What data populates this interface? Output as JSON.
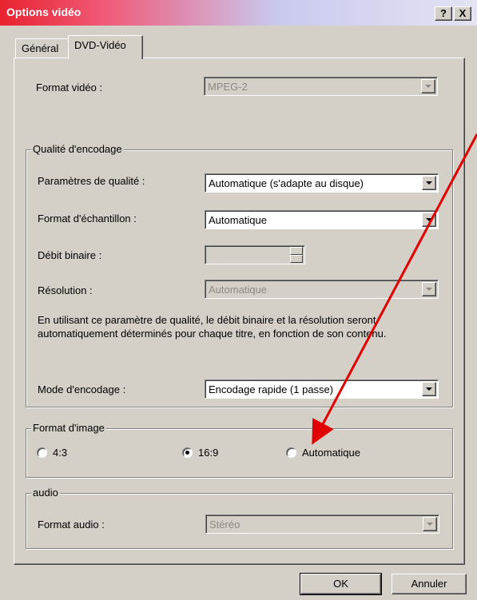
{
  "window": {
    "title": "Options vidéo",
    "help_button": "?",
    "close_button": "X"
  },
  "tabs": [
    {
      "label": "Général",
      "active": false
    },
    {
      "label": "DVD-Vidéo",
      "active": true
    }
  ],
  "video_format": {
    "label": "Format vidéo :",
    "value": "MPEG-2"
  },
  "encoding_quality": {
    "group_label": "Qualité d'encodage",
    "quality_label": "Paramètres de qualité :",
    "quality_value": "Automatique (s'adapte au disque)",
    "sample_format_label": "Format d'échantillon :",
    "sample_format_value": "Automatique",
    "bitrate_label": "Débit binaire :",
    "bitrate_value": "",
    "resolution_label": "Résolution :",
    "resolution_value": "Automatique",
    "description_line1": "En utilisant ce paramètre de qualité, le débit binaire et la résolution seront",
    "description_line2": "automatiquement déterminés pour chaque titre, en fonction de son contenu.",
    "encoding_mode_label": "Mode d'encodage :",
    "encoding_mode_value": "Encodage rapide (1 passe)"
  },
  "aspect_ratio": {
    "group_label": "Format d'image",
    "options": [
      {
        "label": "4:3",
        "checked": false
      },
      {
        "label": "16:9",
        "checked": true
      },
      {
        "label": "Automatique",
        "checked": false
      }
    ]
  },
  "audio": {
    "group_label": "audio",
    "format_label": "Format audio :",
    "format_value": "Stéréo"
  },
  "buttons": {
    "ok": "OK",
    "cancel": "Annuler"
  },
  "annotation": {
    "arrow_color": "#e00000",
    "points_to": "Automatique"
  },
  "colors": {
    "titlebar_start": "#e8232f",
    "face": "#d4d0c8"
  }
}
